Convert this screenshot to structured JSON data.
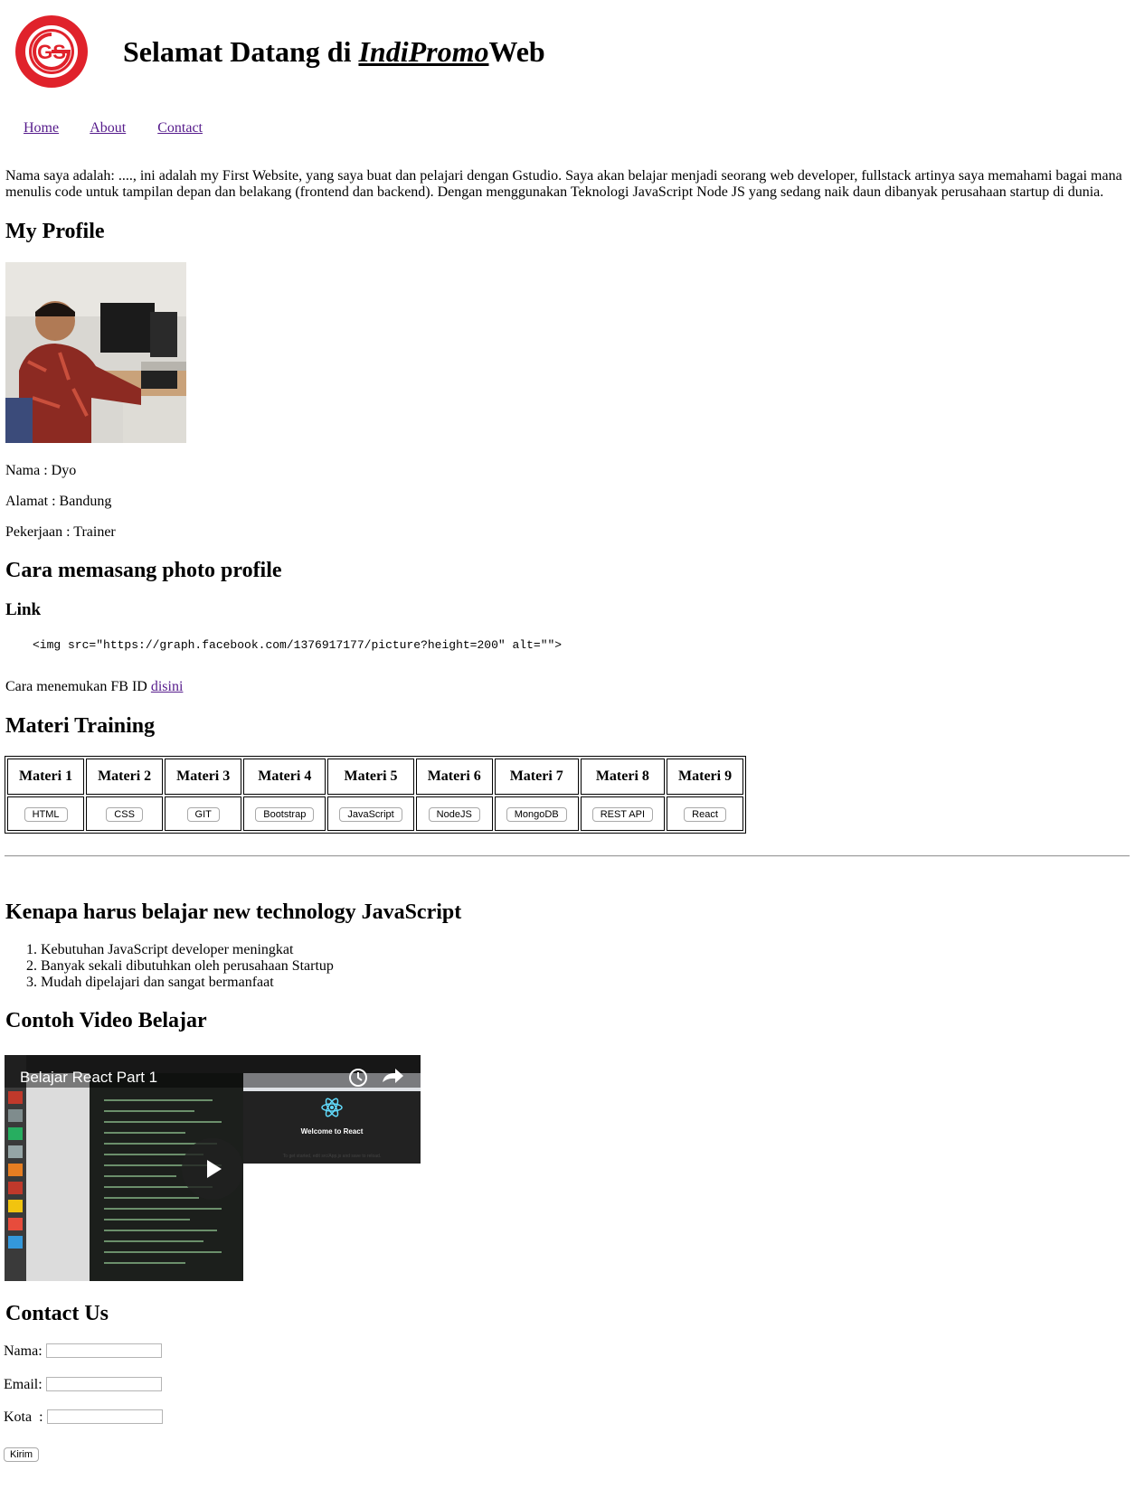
{
  "header": {
    "logo_text": "GANDRUNG STUDIO",
    "logo_letters": "GS",
    "title_prefix": "Selamat Datang di ",
    "title_brand": "IndiPromo",
    "title_suffix": "Web"
  },
  "nav": {
    "items": [
      "Home",
      "About",
      "Contact"
    ]
  },
  "intro": "Nama saya adalah: ...., ini adalah my First Website, yang saya buat dan pelajari dengan Gstudio. Saya akan belajar menjadi seorang web developer, fullstack artinya saya memahami bagai mana menulis code untuk tampilan depan dan belakang (frontend dan backend). Dengan menggunakan Teknologi JavaScript Node JS yang sedang naik daun dibanyak perusahaan startup di dunia.",
  "profile": {
    "heading": "My Profile",
    "nama": "Nama : Dyo",
    "alamat": "Alamat : Bandung",
    "pekerjaan": "Pekerjaan : Trainer"
  },
  "photo_section": {
    "heading": "Cara memasang photo profile",
    "subheading": "Link",
    "code": "<img src=\"https://graph.facebook.com/1376917177/picture?height=200\" alt=\"\">",
    "find_text": "Cara menemukan FB ID ",
    "find_link": "disini"
  },
  "materi": {
    "heading": "Materi Training",
    "headers": [
      "Materi 1",
      "Materi 2",
      "Materi 3",
      "Materi 4",
      "Materi 5",
      "Materi 6",
      "Materi 7",
      "Materi 8",
      "Materi 9"
    ],
    "buttons": [
      "HTML",
      "CSS",
      "GIT",
      "Bootstrap",
      "JavaScript",
      "NodeJS",
      "MongoDB",
      "REST API",
      "React"
    ]
  },
  "reasons": {
    "heading": "Kenapa harus belajar new technology JavaScript",
    "items": [
      "Kebutuhan JavaScript developer meningkat",
      "Banyak sekali dibutuhkan oleh perusahaan Startup",
      "Mudah dipelajari dan sangat bermanfaat"
    ]
  },
  "video": {
    "heading": "Contoh Video Belajar",
    "title": "Belajar React Part 1",
    "welcome": "Welcome to React",
    "hint": "To get started, edit src/App.js and save to reload."
  },
  "contact": {
    "heading": "Contact Us",
    "nama_label": "Nama:",
    "email_label": "Email:",
    "kota_label": "Kota  :",
    "submit": "Kirim"
  },
  "colors": {
    "logo_red": "#e0222b",
    "link": "#551a8b"
  }
}
